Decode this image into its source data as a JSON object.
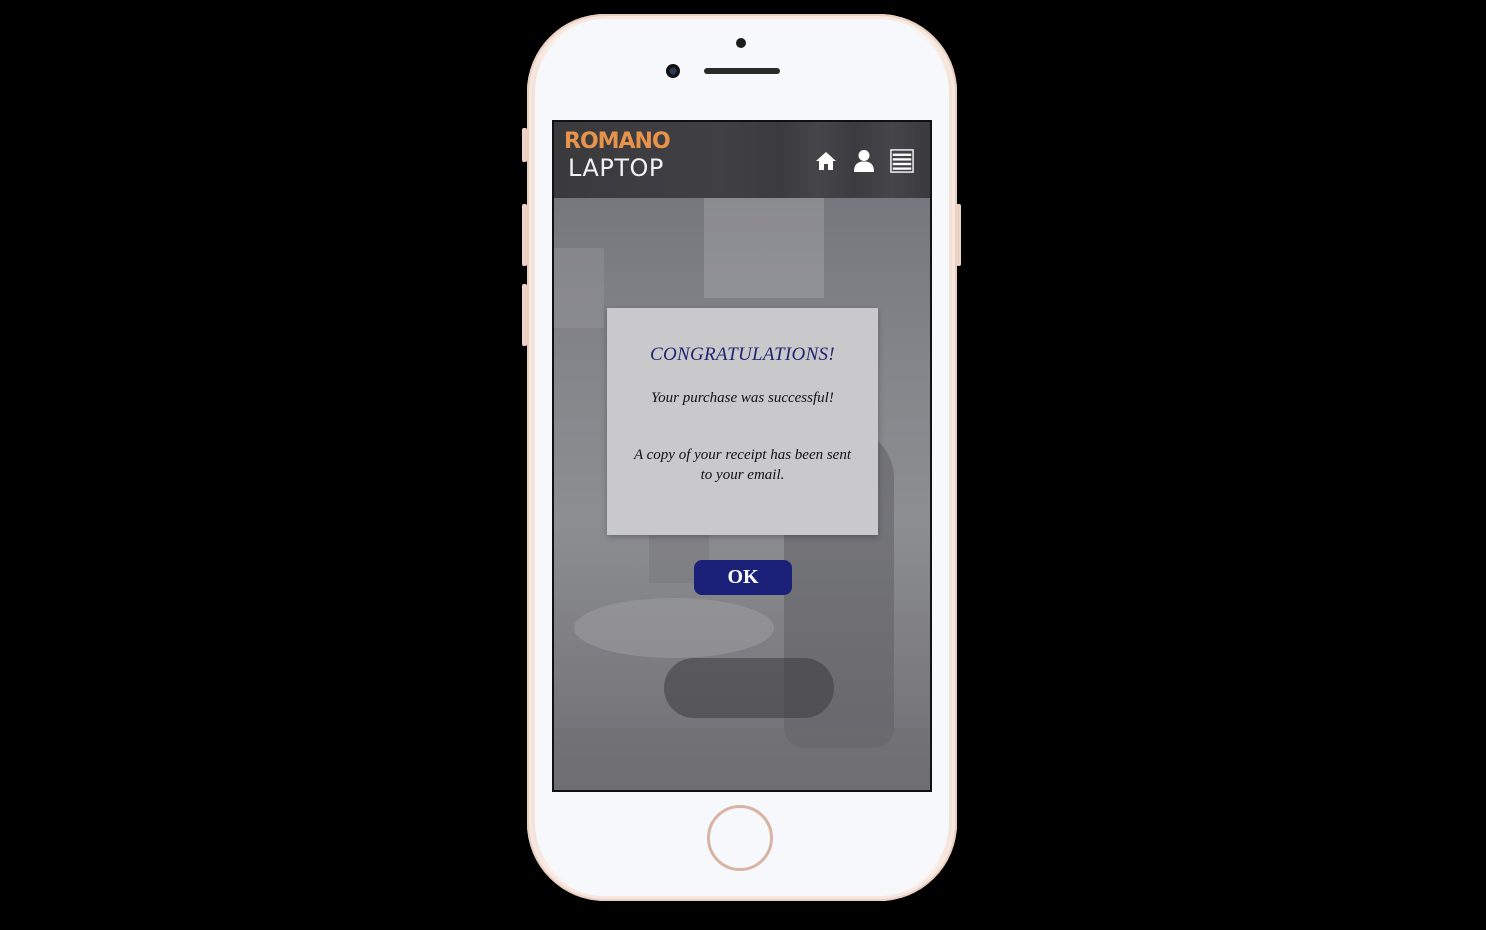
{
  "header": {
    "logo_top": "ROMANO",
    "logo_bottom": "LAPTOP",
    "icons": [
      "home-icon",
      "user-icon",
      "menu-icon"
    ]
  },
  "modal": {
    "title": "CONGRATULATIONS!",
    "line1": "Your purchase was successful!",
    "line2": "A copy of your receipt has been sent to your email."
  },
  "ok_button": {
    "label": "OK"
  },
  "colors": {
    "brand_orange": "#e8934a",
    "button_blue": "#1b2179",
    "title_blue": "#1f2470",
    "header_bg": "#3f3f43"
  }
}
